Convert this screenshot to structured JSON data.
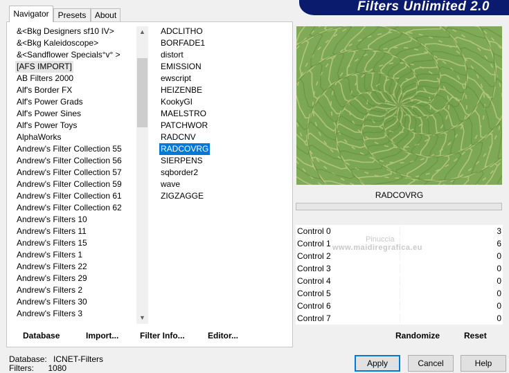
{
  "tabs": [
    "Navigator",
    "Presets",
    "About"
  ],
  "banner": "Filters Unlimited 2.0",
  "categories": [
    "&<Bkg Designers sf10 IV>",
    "&<Bkg Kaleidoscope>",
    "&<Sandflower Specials°v° >",
    "[AFS IMPORT]",
    "AB Filters 2000",
    "Alf's Border FX",
    "Alf's Power Grads",
    "Alf's Power Sines",
    "Alf's Power Toys",
    "AlphaWorks",
    "Andrew's Filter Collection 55",
    "Andrew's Filter Collection 56",
    "Andrew's Filter Collection 57",
    "Andrew's Filter Collection 59",
    "Andrew's Filter Collection 61",
    "Andrew's Filter Collection 62",
    "Andrew's Filters 10",
    "Andrew's Filters 11",
    "Andrew's Filters 15",
    "Andrew's Filters 1",
    "Andrew's Filters 22",
    "Andrew's Filters 29",
    "Andrew's Filters 2",
    "Andrew's Filters 30",
    "Andrew's Filters 3"
  ],
  "selected_category_index": 3,
  "filters": [
    "ADCLITHO",
    "BORFADE1",
    "distort",
    "EMISSION",
    "ewscript",
    "HEIZENBE",
    "KookyGI",
    "MAELSTRO",
    "PATCHWOR",
    "RADCNV",
    "RADCOVRG",
    "SIERPENS",
    "sqborder2",
    "wave",
    "ZIGZAGGE"
  ],
  "selected_filter_index": 10,
  "left_buttons": [
    "Database",
    "Import...",
    "Filter Info...",
    "Editor..."
  ],
  "filter_name": "RADCOVRG",
  "controls": [
    {
      "label": "Control 0",
      "value": "3"
    },
    {
      "label": "Control 1",
      "value": "6"
    },
    {
      "label": "Control 2",
      "value": "0"
    },
    {
      "label": "Control 3",
      "value": "0"
    },
    {
      "label": "Control 4",
      "value": "0"
    },
    {
      "label": "Control 5",
      "value": "0"
    },
    {
      "label": "Control 6",
      "value": "0"
    },
    {
      "label": "Control 7",
      "value": "0"
    }
  ],
  "right_buttons": [
    "Randomize",
    "Reset"
  ],
  "status": {
    "database_label": "Database:",
    "database_value": "ICNET-Filters",
    "filters_label": "Filters:",
    "filters_value": "1080"
  },
  "dialog_buttons": [
    "Apply",
    "Cancel",
    "Help"
  ],
  "watermark": [
    "Pinuccia",
    "www.maidiregrafica.eu"
  ],
  "colors": {
    "accent": "#0078d7",
    "banner": "#0a1b6e",
    "preview": "#7aa453"
  }
}
